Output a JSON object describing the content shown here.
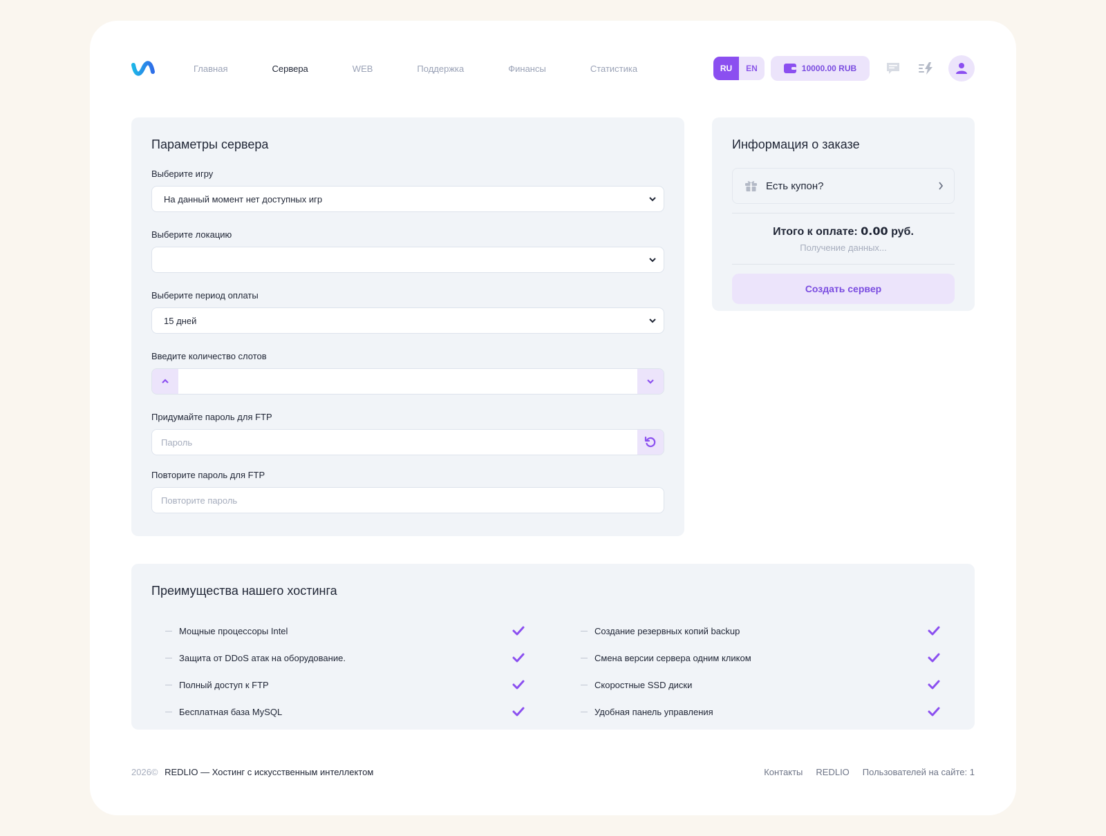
{
  "nav": {
    "items": [
      {
        "label": "Главная",
        "active": false
      },
      {
        "label": "Сервера",
        "active": true
      },
      {
        "label": "WEB",
        "active": false
      },
      {
        "label": "Поддержка",
        "active": false
      },
      {
        "label": "Финансы",
        "active": false
      },
      {
        "label": "Статистика",
        "active": false
      }
    ]
  },
  "header": {
    "lang_ru": "RU",
    "lang_en": "EN",
    "balance": "10000.00 RUB"
  },
  "params": {
    "title": "Параметры сервера",
    "game_label": "Выберите игру",
    "game_value": "На данный момент нет доступных игр",
    "location_label": "Выберите локацию",
    "location_value": "",
    "period_label": "Выберите период оплаты",
    "period_value": "15 дней",
    "slots_label": "Введите количество слотов",
    "slots_value": "",
    "ftp_label": "Придумайте пароль для FTP",
    "ftp_placeholder": "Пароль",
    "ftp_repeat_label": "Повторите пароль для FTP",
    "ftp_repeat_placeholder": "Повторите пароль"
  },
  "order": {
    "title": "Информация о заказе",
    "coupon": "Есть купон?",
    "total_label": "Итого к оплате:",
    "total_value": "0.00",
    "total_currency": "руб.",
    "loading": "Получение данных...",
    "create_button": "Создать сервер"
  },
  "advantages": {
    "title": "Преимущества нашего хостинга",
    "left": [
      "Мощные процессоры Intel",
      "Защита от DDoS атак на оборудование.",
      "Полный доступ к FTP",
      "Бесплатная база MySQL"
    ],
    "right": [
      "Создание резервных копий backup",
      "Смена версии сервера одним кликом",
      "Скоростные SSD диски",
      "Удобная панель управления"
    ]
  },
  "footer": {
    "year": "2026©",
    "brand": "REDLIO — Хостинг с искусственным интеллектом",
    "links": [
      "Контакты",
      "REDLIO",
      "Пользователей на сайте: 1"
    ]
  },
  "colors": {
    "accent": "#8b4ff0",
    "accent_light": "#ece4fb",
    "card_bg": "#f1f4f8",
    "page_bg": "#faf6ef"
  }
}
